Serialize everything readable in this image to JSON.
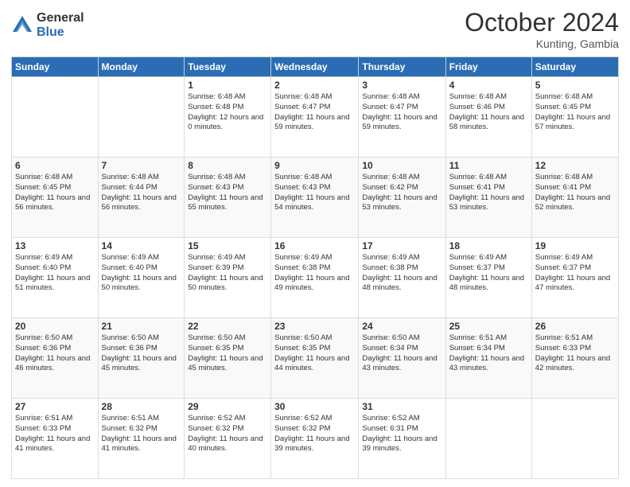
{
  "header": {
    "logo_general": "General",
    "logo_blue": "Blue",
    "month_title": "October 2024",
    "location": "Kunting, Gambia"
  },
  "days_of_week": [
    "Sunday",
    "Monday",
    "Tuesday",
    "Wednesday",
    "Thursday",
    "Friday",
    "Saturday"
  ],
  "weeks": [
    [
      {
        "day": "",
        "sunrise": "",
        "sunset": "",
        "daylight": ""
      },
      {
        "day": "",
        "sunrise": "",
        "sunset": "",
        "daylight": ""
      },
      {
        "day": "1",
        "sunrise": "Sunrise: 6:48 AM",
        "sunset": "Sunset: 6:48 PM",
        "daylight": "Daylight: 12 hours and 0 minutes."
      },
      {
        "day": "2",
        "sunrise": "Sunrise: 6:48 AM",
        "sunset": "Sunset: 6:47 PM",
        "daylight": "Daylight: 11 hours and 59 minutes."
      },
      {
        "day": "3",
        "sunrise": "Sunrise: 6:48 AM",
        "sunset": "Sunset: 6:47 PM",
        "daylight": "Daylight: 11 hours and 59 minutes."
      },
      {
        "day": "4",
        "sunrise": "Sunrise: 6:48 AM",
        "sunset": "Sunset: 6:46 PM",
        "daylight": "Daylight: 11 hours and 58 minutes."
      },
      {
        "day": "5",
        "sunrise": "Sunrise: 6:48 AM",
        "sunset": "Sunset: 6:45 PM",
        "daylight": "Daylight: 11 hours and 57 minutes."
      }
    ],
    [
      {
        "day": "6",
        "sunrise": "Sunrise: 6:48 AM",
        "sunset": "Sunset: 6:45 PM",
        "daylight": "Daylight: 11 hours and 56 minutes."
      },
      {
        "day": "7",
        "sunrise": "Sunrise: 6:48 AM",
        "sunset": "Sunset: 6:44 PM",
        "daylight": "Daylight: 11 hours and 56 minutes."
      },
      {
        "day": "8",
        "sunrise": "Sunrise: 6:48 AM",
        "sunset": "Sunset: 6:43 PM",
        "daylight": "Daylight: 11 hours and 55 minutes."
      },
      {
        "day": "9",
        "sunrise": "Sunrise: 6:48 AM",
        "sunset": "Sunset: 6:43 PM",
        "daylight": "Daylight: 11 hours and 54 minutes."
      },
      {
        "day": "10",
        "sunrise": "Sunrise: 6:48 AM",
        "sunset": "Sunset: 6:42 PM",
        "daylight": "Daylight: 11 hours and 53 minutes."
      },
      {
        "day": "11",
        "sunrise": "Sunrise: 6:48 AM",
        "sunset": "Sunset: 6:41 PM",
        "daylight": "Daylight: 11 hours and 53 minutes."
      },
      {
        "day": "12",
        "sunrise": "Sunrise: 6:48 AM",
        "sunset": "Sunset: 6:41 PM",
        "daylight": "Daylight: 11 hours and 52 minutes."
      }
    ],
    [
      {
        "day": "13",
        "sunrise": "Sunrise: 6:49 AM",
        "sunset": "Sunset: 6:40 PM",
        "daylight": "Daylight: 11 hours and 51 minutes."
      },
      {
        "day": "14",
        "sunrise": "Sunrise: 6:49 AM",
        "sunset": "Sunset: 6:40 PM",
        "daylight": "Daylight: 11 hours and 50 minutes."
      },
      {
        "day": "15",
        "sunrise": "Sunrise: 6:49 AM",
        "sunset": "Sunset: 6:39 PM",
        "daylight": "Daylight: 11 hours and 50 minutes."
      },
      {
        "day": "16",
        "sunrise": "Sunrise: 6:49 AM",
        "sunset": "Sunset: 6:38 PM",
        "daylight": "Daylight: 11 hours and 49 minutes."
      },
      {
        "day": "17",
        "sunrise": "Sunrise: 6:49 AM",
        "sunset": "Sunset: 6:38 PM",
        "daylight": "Daylight: 11 hours and 48 minutes."
      },
      {
        "day": "18",
        "sunrise": "Sunrise: 6:49 AM",
        "sunset": "Sunset: 6:37 PM",
        "daylight": "Daylight: 11 hours and 48 minutes."
      },
      {
        "day": "19",
        "sunrise": "Sunrise: 6:49 AM",
        "sunset": "Sunset: 6:37 PM",
        "daylight": "Daylight: 11 hours and 47 minutes."
      }
    ],
    [
      {
        "day": "20",
        "sunrise": "Sunrise: 6:50 AM",
        "sunset": "Sunset: 6:36 PM",
        "daylight": "Daylight: 11 hours and 46 minutes."
      },
      {
        "day": "21",
        "sunrise": "Sunrise: 6:50 AM",
        "sunset": "Sunset: 6:36 PM",
        "daylight": "Daylight: 11 hours and 45 minutes."
      },
      {
        "day": "22",
        "sunrise": "Sunrise: 6:50 AM",
        "sunset": "Sunset: 6:35 PM",
        "daylight": "Daylight: 11 hours and 45 minutes."
      },
      {
        "day": "23",
        "sunrise": "Sunrise: 6:50 AM",
        "sunset": "Sunset: 6:35 PM",
        "daylight": "Daylight: 11 hours and 44 minutes."
      },
      {
        "day": "24",
        "sunrise": "Sunrise: 6:50 AM",
        "sunset": "Sunset: 6:34 PM",
        "daylight": "Daylight: 11 hours and 43 minutes."
      },
      {
        "day": "25",
        "sunrise": "Sunrise: 6:51 AM",
        "sunset": "Sunset: 6:34 PM",
        "daylight": "Daylight: 11 hours and 43 minutes."
      },
      {
        "day": "26",
        "sunrise": "Sunrise: 6:51 AM",
        "sunset": "Sunset: 6:33 PM",
        "daylight": "Daylight: 11 hours and 42 minutes."
      }
    ],
    [
      {
        "day": "27",
        "sunrise": "Sunrise: 6:51 AM",
        "sunset": "Sunset: 6:33 PM",
        "daylight": "Daylight: 11 hours and 41 minutes."
      },
      {
        "day": "28",
        "sunrise": "Sunrise: 6:51 AM",
        "sunset": "Sunset: 6:32 PM",
        "daylight": "Daylight: 11 hours and 41 minutes."
      },
      {
        "day": "29",
        "sunrise": "Sunrise: 6:52 AM",
        "sunset": "Sunset: 6:32 PM",
        "daylight": "Daylight: 11 hours and 40 minutes."
      },
      {
        "day": "30",
        "sunrise": "Sunrise: 6:52 AM",
        "sunset": "Sunset: 6:32 PM",
        "daylight": "Daylight: 11 hours and 39 minutes."
      },
      {
        "day": "31",
        "sunrise": "Sunrise: 6:52 AM",
        "sunset": "Sunset: 6:31 PM",
        "daylight": "Daylight: 11 hours and 39 minutes."
      },
      {
        "day": "",
        "sunrise": "",
        "sunset": "",
        "daylight": ""
      },
      {
        "day": "",
        "sunrise": "",
        "sunset": "",
        "daylight": ""
      }
    ]
  ]
}
